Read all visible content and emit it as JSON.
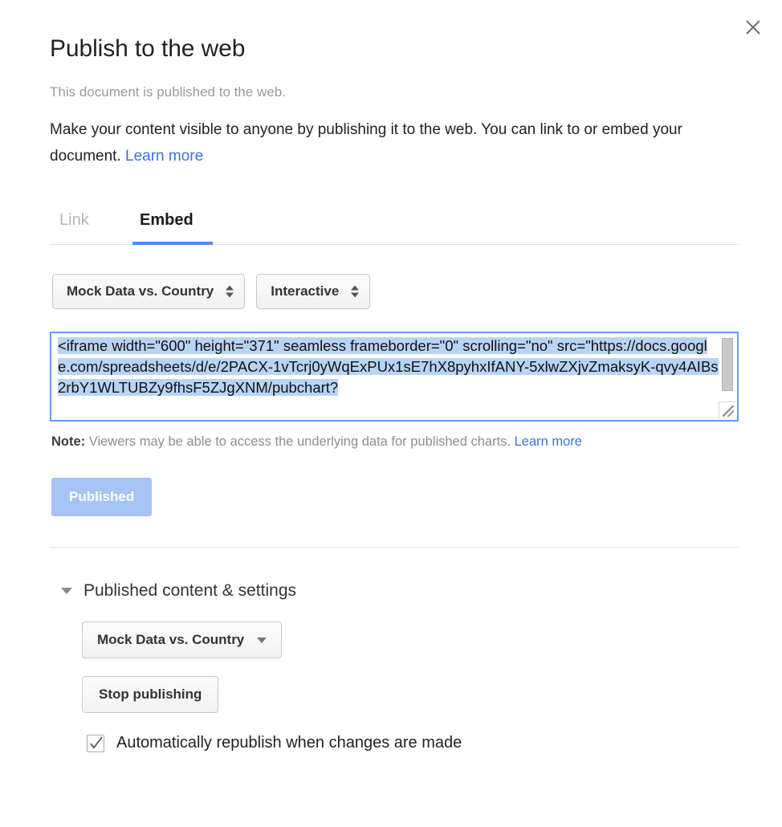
{
  "dialog": {
    "title": "Publish to the web",
    "status_text": "This document is published to the web.",
    "description_main": "Make your content visible to anyone by publishing it to the web. You can link to or embed your document. ",
    "description_link": "Learn more",
    "close_icon": "close-icon"
  },
  "tabs": [
    {
      "label": "Link",
      "active": false
    },
    {
      "label": "Embed",
      "active": true
    }
  ],
  "embed_controls": {
    "chart_select_value": "Mock Data vs. Country",
    "format_select_value": "Interactive"
  },
  "embed_code": {
    "value": "<iframe width=\"600\" height=\"371\" seamless frameborder=\"0\" scrolling=\"no\" src=\"https://docs.google.com/spreadsheets/d/e/2PACX-1vTcrj0yWqExPUx1sE7hX8pyhxIfANY-5xlwZXjvZmaksyK-qvy4AIBs2rbY1WLTUBZy9fhsF5ZJgXNM/pubchart?"
  },
  "note": {
    "label": "Note:",
    "text": " Viewers may be able to access the underlying data for published charts. ",
    "link": "Learn more"
  },
  "published_button": {
    "label": "Published"
  },
  "settings": {
    "section_label": "Published content & settings",
    "chart_menu_value": "Mock Data vs. Country",
    "stop_publishing_label": "Stop publishing",
    "auto_republish_label": "Automatically republish when changes are made",
    "auto_republish_checked": true
  },
  "colors": {
    "accent_blue": "#4a8cf7",
    "link_blue": "#3b73d2",
    "selection_blue": "#b8d4f5",
    "published_button_blue": "#a5c4f5",
    "muted_grey": "#9b9b9b"
  }
}
